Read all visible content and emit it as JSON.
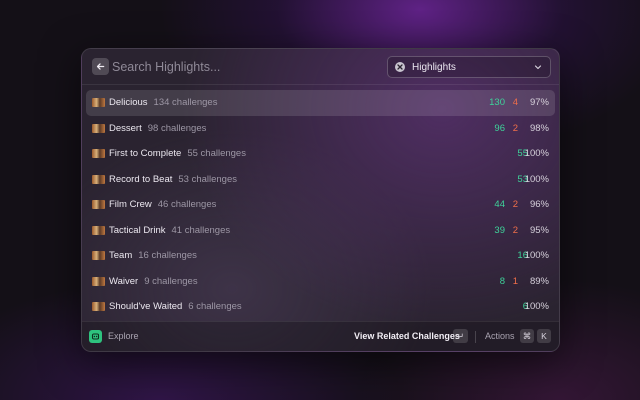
{
  "search": {
    "placeholder": "Search Highlights..."
  },
  "filter": {
    "selected": "Highlights",
    "icon": "close-circle-icon"
  },
  "rows": [
    {
      "name": "Delicious",
      "count": "134 challenges",
      "green": "130",
      "red": "4",
      "pct": "97%"
    },
    {
      "name": "Dessert",
      "count": "98 challenges",
      "green": "96",
      "red": "2",
      "pct": "98%"
    },
    {
      "name": "First to Complete",
      "count": "55 challenges",
      "green": "55",
      "red": "",
      "pct": "100%"
    },
    {
      "name": "Record to Beat",
      "count": "53 challenges",
      "green": "53",
      "red": "",
      "pct": "100%"
    },
    {
      "name": "Film Crew",
      "count": "46 challenges",
      "green": "44",
      "red": "2",
      "pct": "96%"
    },
    {
      "name": "Tactical Drink",
      "count": "41 challenges",
      "green": "39",
      "red": "2",
      "pct": "95%"
    },
    {
      "name": "Team",
      "count": "16 challenges",
      "green": "16",
      "red": "",
      "pct": "100%"
    },
    {
      "name": "Waiver",
      "count": "9 challenges",
      "green": "8",
      "red": "1",
      "pct": "89%"
    },
    {
      "name": "Should've Waited",
      "count": "6 challenges",
      "green": "6",
      "red": "",
      "pct": "100%"
    }
  ],
  "footer": {
    "explore_label": "Explore",
    "view_related_label": "View Related Challenges",
    "enter_key": "↵",
    "actions_label": "Actions",
    "cmd_key": "⌘",
    "k_key": "K"
  },
  "colors": {
    "green": "#3ed39a",
    "red": "#ef6e4a",
    "explore_accent": "#2ec27e"
  }
}
